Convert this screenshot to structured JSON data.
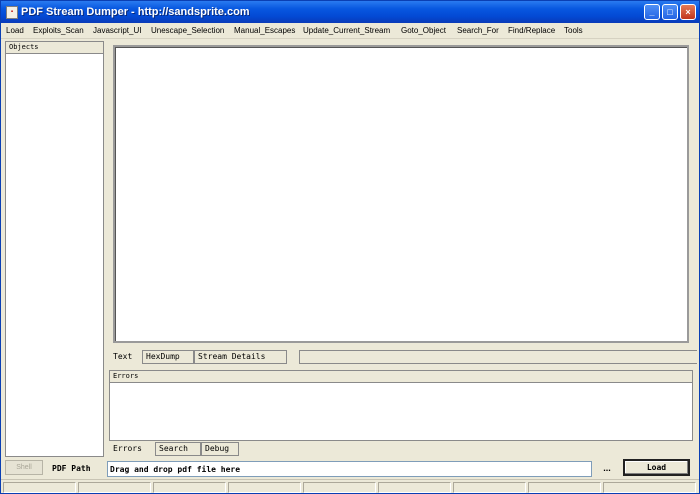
{
  "window": {
    "title": "PDF Stream Dumper - http://sandsprite.com",
    "minimize_glyph": "_",
    "maximize_glyph": "□",
    "close_glyph": "×",
    "app_icon": "pdf-app-icon"
  },
  "menu": {
    "items": [
      {
        "label": "Load"
      },
      {
        "label": "Exploits_Scan"
      },
      {
        "label": "Javascript_UI"
      },
      {
        "label": "Unescape_Selection"
      },
      {
        "label": "Manual_Escapes"
      },
      {
        "label": "Update_Current_Stream"
      },
      {
        "label": "Goto_Object"
      },
      {
        "label": "Search_For"
      },
      {
        "label": "Find/Replace"
      },
      {
        "label": "Tools"
      }
    ]
  },
  "objects_panel": {
    "header": "Objects"
  },
  "viewer_tabs": [
    {
      "label": "Text",
      "active": true
    },
    {
      "label": "HexDump",
      "active": false
    },
    {
      "label": "Stream Details",
      "active": false
    }
  ],
  "errors_panel": {
    "header": "Errors"
  },
  "bottom_tabs": [
    {
      "label": "Errors",
      "active": true
    },
    {
      "label": "Search",
      "active": false
    },
    {
      "label": "Debug",
      "active": false
    }
  ],
  "footer": {
    "shell_label": "Shell",
    "pdf_path_label": "PDF Path",
    "pdf_path_value": "Drag and drop pdf file here",
    "browse_label": "...",
    "load_label": "Load"
  }
}
